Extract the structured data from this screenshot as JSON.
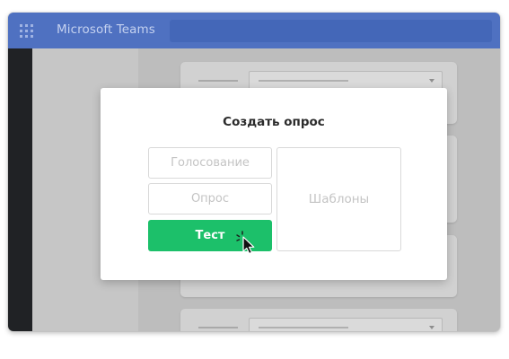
{
  "app": {
    "title": "Microsoft Teams"
  },
  "search": {
    "placeholder": ""
  },
  "dialog": {
    "title": "Создать опрос",
    "options": {
      "vote": "Голосование",
      "poll": "Опрос",
      "test": "Тест",
      "templates": "Шаблоны"
    }
  },
  "colors": {
    "titlebar": "#4f71c1",
    "rail": "#202225",
    "accent_green": "#1cc06a",
    "option_border": "#d9d9d9"
  },
  "icons": [
    "app-launcher-icon",
    "cursor-pointer-icon",
    "click-burst-icon",
    "dropdown-caret-icon"
  ]
}
